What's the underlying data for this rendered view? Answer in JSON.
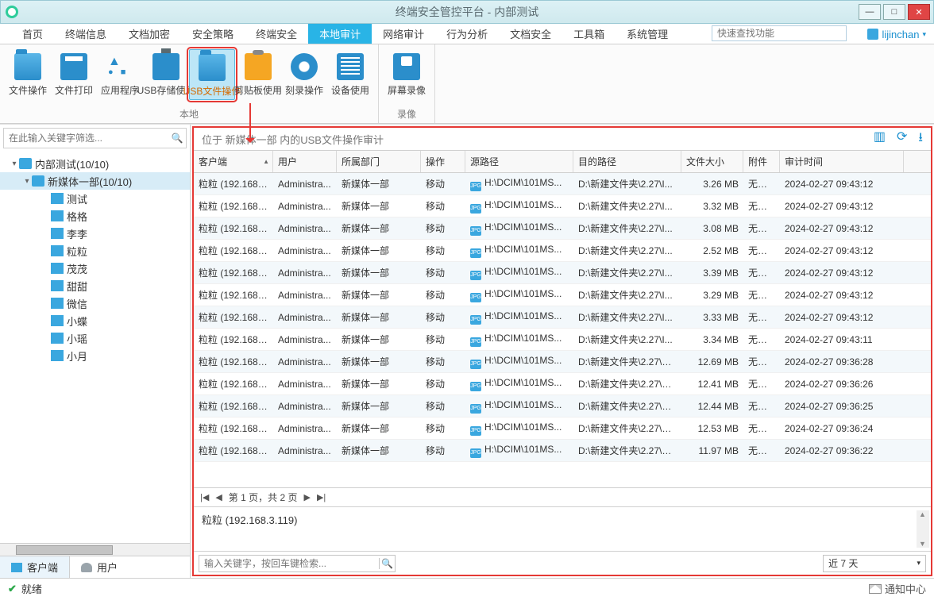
{
  "window": {
    "title": "终端安全管控平台 - 内部测试"
  },
  "topSearchPlaceholder": "快速查找功能",
  "username": "lijinchan",
  "menuTabs": [
    "首页",
    "终端信息",
    "文档加密",
    "安全策略",
    "终端安全",
    "本地审计",
    "网络审计",
    "行为分析",
    "文档安全",
    "工具箱",
    "系统管理"
  ],
  "menuActiveIndex": 5,
  "ribbon": {
    "groups": [
      {
        "label": "本地",
        "items": [
          {
            "label": "文件操作",
            "icon": "folder"
          },
          {
            "label": "文件打印",
            "icon": "printer"
          },
          {
            "label": "应用程序",
            "icon": "app"
          },
          {
            "label": "USB存储使用",
            "icon": "usb"
          },
          {
            "label": "USB文件操作",
            "icon": "folder",
            "selected": true
          },
          {
            "label": "剪贴板使用",
            "icon": "clip"
          },
          {
            "label": "刻录操作",
            "icon": "disc"
          },
          {
            "label": "设备使用",
            "icon": "device"
          }
        ]
      },
      {
        "label": "录像",
        "items": [
          {
            "label": "屏幕录像",
            "icon": "record"
          }
        ]
      }
    ]
  },
  "sidebar": {
    "filterPlaceholder": "在此输入关键字筛选...",
    "root": {
      "label": "内部测试(10/10)"
    },
    "group": {
      "label": "新媒体一部(10/10)"
    },
    "clients": [
      "测试",
      "格格",
      "李李",
      "粒粒",
      "茂茂",
      "甜甜",
      "微信",
      "小蝶",
      "小瑶",
      "小月"
    ],
    "tabs": {
      "client": "客户端",
      "user": "用户"
    }
  },
  "contentHeader": "位于 新媒体一部 内的USB文件操作审计",
  "columns": [
    "客户端",
    "用户",
    "所属部门",
    "操作",
    "源路径",
    "目的路径",
    "文件大小",
    "附件",
    "审计时间"
  ],
  "rows": [
    {
      "client": "粒粒 (192.168.3...",
      "user": "Administra...",
      "dept": "新媒体一部",
      "op": "移动",
      "src": "H:\\DCIM\\101MS...",
      "dst": "D:\\新建文件夹\\2.27\\I...",
      "size": "3.26 MB",
      "att": "无附件",
      "time": "2024-02-27 09:43:12"
    },
    {
      "client": "粒粒 (192.168.3...",
      "user": "Administra...",
      "dept": "新媒体一部",
      "op": "移动",
      "src": "H:\\DCIM\\101MS...",
      "dst": "D:\\新建文件夹\\2.27\\I...",
      "size": "3.32 MB",
      "att": "无附件",
      "time": "2024-02-27 09:43:12"
    },
    {
      "client": "粒粒 (192.168.3...",
      "user": "Administra...",
      "dept": "新媒体一部",
      "op": "移动",
      "src": "H:\\DCIM\\101MS...",
      "dst": "D:\\新建文件夹\\2.27\\I...",
      "size": "3.08 MB",
      "att": "无附件",
      "time": "2024-02-27 09:43:12"
    },
    {
      "client": "粒粒 (192.168.3...",
      "user": "Administra...",
      "dept": "新媒体一部",
      "op": "移动",
      "src": "H:\\DCIM\\101MS...",
      "dst": "D:\\新建文件夹\\2.27\\I...",
      "size": "2.52 MB",
      "att": "无附件",
      "time": "2024-02-27 09:43:12"
    },
    {
      "client": "粒粒 (192.168.3...",
      "user": "Administra...",
      "dept": "新媒体一部",
      "op": "移动",
      "src": "H:\\DCIM\\101MS...",
      "dst": "D:\\新建文件夹\\2.27\\I...",
      "size": "3.39 MB",
      "att": "无附件",
      "time": "2024-02-27 09:43:12"
    },
    {
      "client": "粒粒 (192.168.3...",
      "user": "Administra...",
      "dept": "新媒体一部",
      "op": "移动",
      "src": "H:\\DCIM\\101MS...",
      "dst": "D:\\新建文件夹\\2.27\\I...",
      "size": "3.29 MB",
      "att": "无附件",
      "time": "2024-02-27 09:43:12"
    },
    {
      "client": "粒粒 (192.168.3...",
      "user": "Administra...",
      "dept": "新媒体一部",
      "op": "移动",
      "src": "H:\\DCIM\\101MS...",
      "dst": "D:\\新建文件夹\\2.27\\I...",
      "size": "3.33 MB",
      "att": "无附件",
      "time": "2024-02-27 09:43:12"
    },
    {
      "client": "粒粒 (192.168.3...",
      "user": "Administra...",
      "dept": "新媒体一部",
      "op": "移动",
      "src": "H:\\DCIM\\101MS...",
      "dst": "D:\\新建文件夹\\2.27\\I...",
      "size": "3.34 MB",
      "att": "无附件",
      "time": "2024-02-27 09:43:11"
    },
    {
      "client": "粒粒 (192.168.3...",
      "user": "Administra...",
      "dept": "新媒体一部",
      "op": "移动",
      "src": "H:\\DCIM\\101MS...",
      "dst": "D:\\新建文件夹\\2.27\\D...",
      "size": "12.69 MB",
      "att": "无附件",
      "time": "2024-02-27 09:36:28"
    },
    {
      "client": "粒粒 (192.168.3...",
      "user": "Administra...",
      "dept": "新媒体一部",
      "op": "移动",
      "src": "H:\\DCIM\\101MS...",
      "dst": "D:\\新建文件夹\\2.27\\D...",
      "size": "12.41 MB",
      "att": "无附件",
      "time": "2024-02-27 09:36:26"
    },
    {
      "client": "粒粒 (192.168.3...",
      "user": "Administra...",
      "dept": "新媒体一部",
      "op": "移动",
      "src": "H:\\DCIM\\101MS...",
      "dst": "D:\\新建文件夹\\2.27\\D...",
      "size": "12.44 MB",
      "att": "无附件",
      "time": "2024-02-27 09:36:25"
    },
    {
      "client": "粒粒 (192.168.3...",
      "user": "Administra...",
      "dept": "新媒体一部",
      "op": "移动",
      "src": "H:\\DCIM\\101MS...",
      "dst": "D:\\新建文件夹\\2.27\\D...",
      "size": "12.53 MB",
      "att": "无附件",
      "time": "2024-02-27 09:36:24"
    },
    {
      "client": "粒粒 (192.168.3...",
      "user": "Administra...",
      "dept": "新媒体一部",
      "op": "移动",
      "src": "H:\\DCIM\\101MS...",
      "dst": "D:\\新建文件夹\\2.27\\D...",
      "size": "11.97 MB",
      "att": "无附件",
      "time": "2024-02-27 09:36:22"
    }
  ],
  "pager": "第 1 页，共 2 页",
  "detailText": "粒粒 (192.168.3.119)",
  "keywordPlaceholder": "输入关键字，按回车键检索...",
  "rangeLabel": "近 7 天",
  "status": {
    "ready": "就绪",
    "notif": "通知中心"
  }
}
